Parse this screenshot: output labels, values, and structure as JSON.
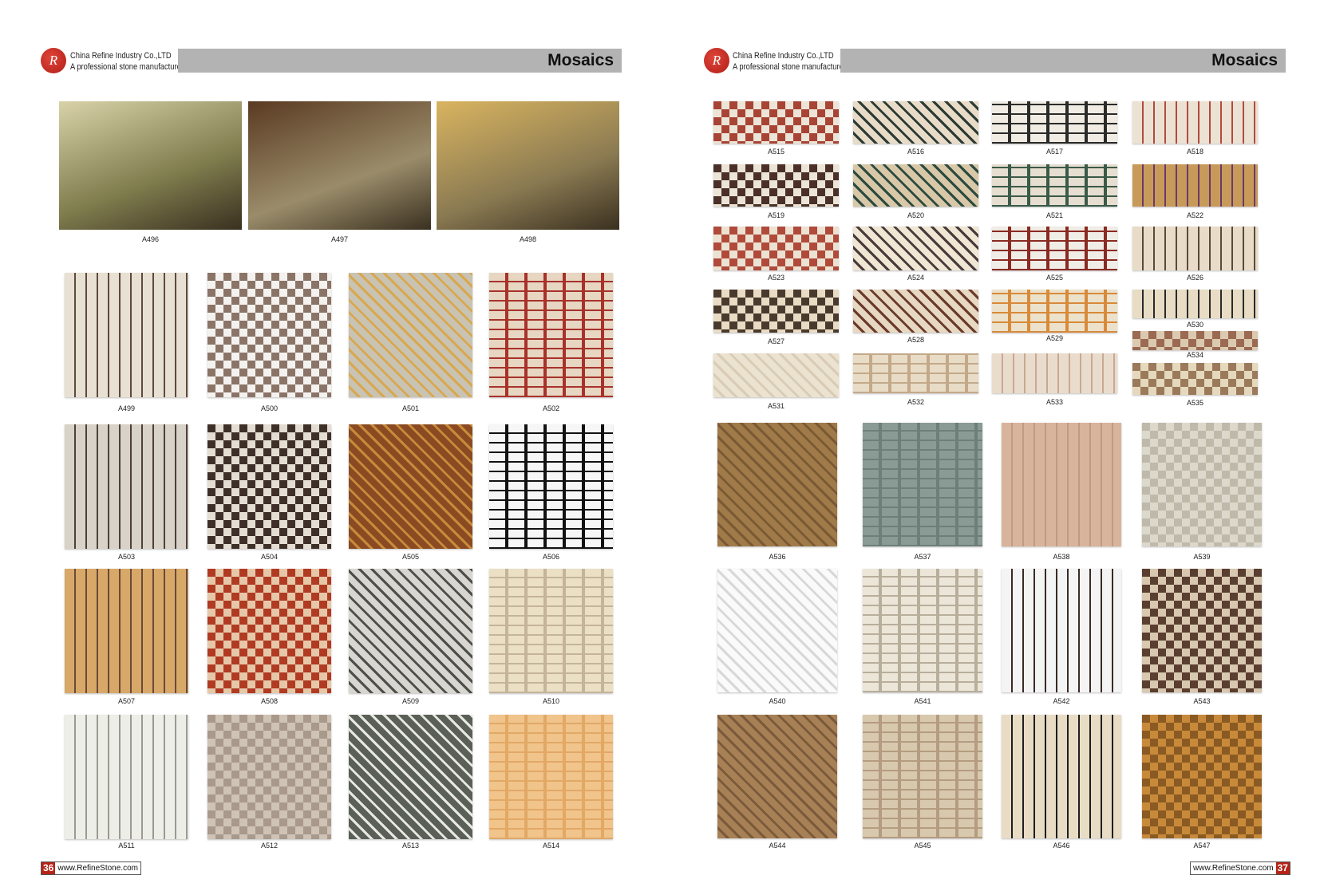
{
  "left_page": {
    "company": "China Refine Industry Co.,LTD",
    "tagline": "A professional stone manufacturer",
    "logo_text": "R",
    "section_title": "Mosaics",
    "photos": [
      {
        "label": "A496",
        "colors": [
          "#7d7a4c",
          "#d9d2a8"
        ]
      },
      {
        "label": "A497",
        "colors": [
          "#9a8c6a",
          "#5a3a22"
        ]
      },
      {
        "label": "A498",
        "colors": [
          "#8a7a52",
          "#d9b460"
        ]
      }
    ],
    "tiles": [
      {
        "label": "A499",
        "colors": [
          "#e8e0d2",
          "#5c4a3e"
        ]
      },
      {
        "label": "A500",
        "colors": [
          "#f4f2ee",
          "#8a7468"
        ]
      },
      {
        "label": "A501",
        "colors": [
          "#c9c3b4",
          "#d8a850"
        ]
      },
      {
        "label": "A502",
        "colors": [
          "#e6d6c2",
          "#a8322a"
        ]
      },
      {
        "label": "A503",
        "colors": [
          "#d8d2c8",
          "#4e4038"
        ]
      },
      {
        "label": "A504",
        "colors": [
          "#e4ddd2",
          "#3e3028"
        ]
      },
      {
        "label": "A505",
        "colors": [
          "#8a4a22",
          "#c88a3a"
        ]
      },
      {
        "label": "A506",
        "colors": [
          "#f6f6f6",
          "#111111"
        ]
      },
      {
        "label": "A507",
        "colors": [
          "#d8a868",
          "#6a4a3a"
        ]
      },
      {
        "label": "A508",
        "colors": [
          "#e6c8a8",
          "#b03a22"
        ]
      },
      {
        "label": "A509",
        "colors": [
          "#d8d6d0",
          "#4e4e4a"
        ]
      },
      {
        "label": "A510",
        "colors": [
          "#ece0c4",
          "#c4b49a"
        ]
      },
      {
        "label": "A511",
        "colors": [
          "#eeeee8",
          "#9a9a92"
        ]
      },
      {
        "label": "A512",
        "colors": [
          "#cfc3b6",
          "#a8998a"
        ]
      },
      {
        "label": "A513",
        "colors": [
          "#5a6058",
          "#e8e8e2"
        ]
      },
      {
        "label": "A514",
        "colors": [
          "#f0c48a",
          "#e2a866"
        ]
      }
    ],
    "footer": {
      "page_number": "36",
      "website": "www.RefineStone.com"
    }
  },
  "right_page": {
    "company": "China Refine Industry Co.,LTD",
    "tagline": "A professional stone manufacturer",
    "logo_text": "R",
    "section_title": "Mosaics",
    "borders": [
      {
        "label": "A515",
        "colors": [
          "#ece4d6",
          "#a84436"
        ]
      },
      {
        "label": "A516",
        "colors": [
          "#e8dcc8",
          "#2c3a34"
        ]
      },
      {
        "label": "A517",
        "colors": [
          "#f0ece4",
          "#2a2a28"
        ]
      },
      {
        "label": "A518",
        "colors": [
          "#ece2d4",
          "#b24a3e"
        ]
      },
      {
        "label": "A519",
        "colors": [
          "#ece4d6",
          "#4a3028"
        ]
      },
      {
        "label": "A520",
        "colors": [
          "#d8c8a8",
          "#2c4a40"
        ]
      },
      {
        "label": "A521",
        "colors": [
          "#e6ded0",
          "#3a5a48"
        ]
      },
      {
        "label": "A522",
        "colors": [
          "#c89a5a",
          "#6a3a6a"
        ]
      },
      {
        "label": "A523",
        "colors": [
          "#ece2d2",
          "#b04a3a"
        ]
      },
      {
        "label": "A524",
        "colors": [
          "#efe6d4",
          "#4a3a3a"
        ]
      },
      {
        "label": "A525",
        "colors": [
          "#f0ece6",
          "#8a2a22"
        ]
      },
      {
        "label": "A526",
        "colors": [
          "#e8dcc8",
          "#5a4a3a"
        ]
      },
      {
        "label": "A527",
        "colors": [
          "#e8dcc4",
          "#4a3a2e"
        ]
      },
      {
        "label": "A528",
        "colors": [
          "#e6d8c2",
          "#6a3a2a"
        ]
      },
      {
        "label": "A529",
        "colors": [
          "#ece2cc",
          "#d88a3a"
        ]
      },
      {
        "label": "A530",
        "colors": [
          "#e8dcc4",
          "#2a2a2a"
        ]
      },
      {
        "label": "A534",
        "colors": [
          "#dccab0",
          "#9a6a52"
        ]
      },
      {
        "label": "A531",
        "colors": [
          "#ece2d0",
          "#d8ccb6"
        ]
      },
      {
        "label": "A532",
        "colors": [
          "#e8dcc6",
          "#c4a88a"
        ]
      },
      {
        "label": "A533",
        "colors": [
          "#eadccc",
          "#c8a894"
        ]
      },
      {
        "label": "A535",
        "colors": [
          "#e6d8bc",
          "#9a7a5a"
        ]
      }
    ],
    "tiles": [
      {
        "label": "A536",
        "colors": [
          "#a07a48",
          "#7a5a34"
        ]
      },
      {
        "label": "A537",
        "colors": [
          "#8a9a94",
          "#6e7e78"
        ]
      },
      {
        "label": "A538",
        "colors": [
          "#d8b49c",
          "#c09a82"
        ]
      },
      {
        "label": "A539",
        "colors": [
          "#dcd8cc",
          "#bfb9aa"
        ]
      },
      {
        "label": "A540",
        "colors": [
          "#fafafa",
          "#d8d8d8"
        ]
      },
      {
        "label": "A541",
        "colors": [
          "#ece6d8",
          "#b8ae9c"
        ]
      },
      {
        "label": "A542",
        "colors": [
          "#f4f4f4",
          "#3a2a26"
        ]
      },
      {
        "label": "A543",
        "colors": [
          "#d8c8b0",
          "#5a3e30"
        ]
      },
      {
        "label": "A544",
        "colors": [
          "#a88056",
          "#7a5a3a"
        ]
      },
      {
        "label": "A545",
        "colors": [
          "#d8c8ae",
          "#b49c80"
        ]
      },
      {
        "label": "A546",
        "colors": [
          "#e8dcc4",
          "#1e1e1e"
        ]
      },
      {
        "label": "A547",
        "colors": [
          "#c88a3a",
          "#8a5a22"
        ]
      }
    ],
    "footer": {
      "page_number": "37",
      "website": "www.RefineStone.com"
    }
  }
}
